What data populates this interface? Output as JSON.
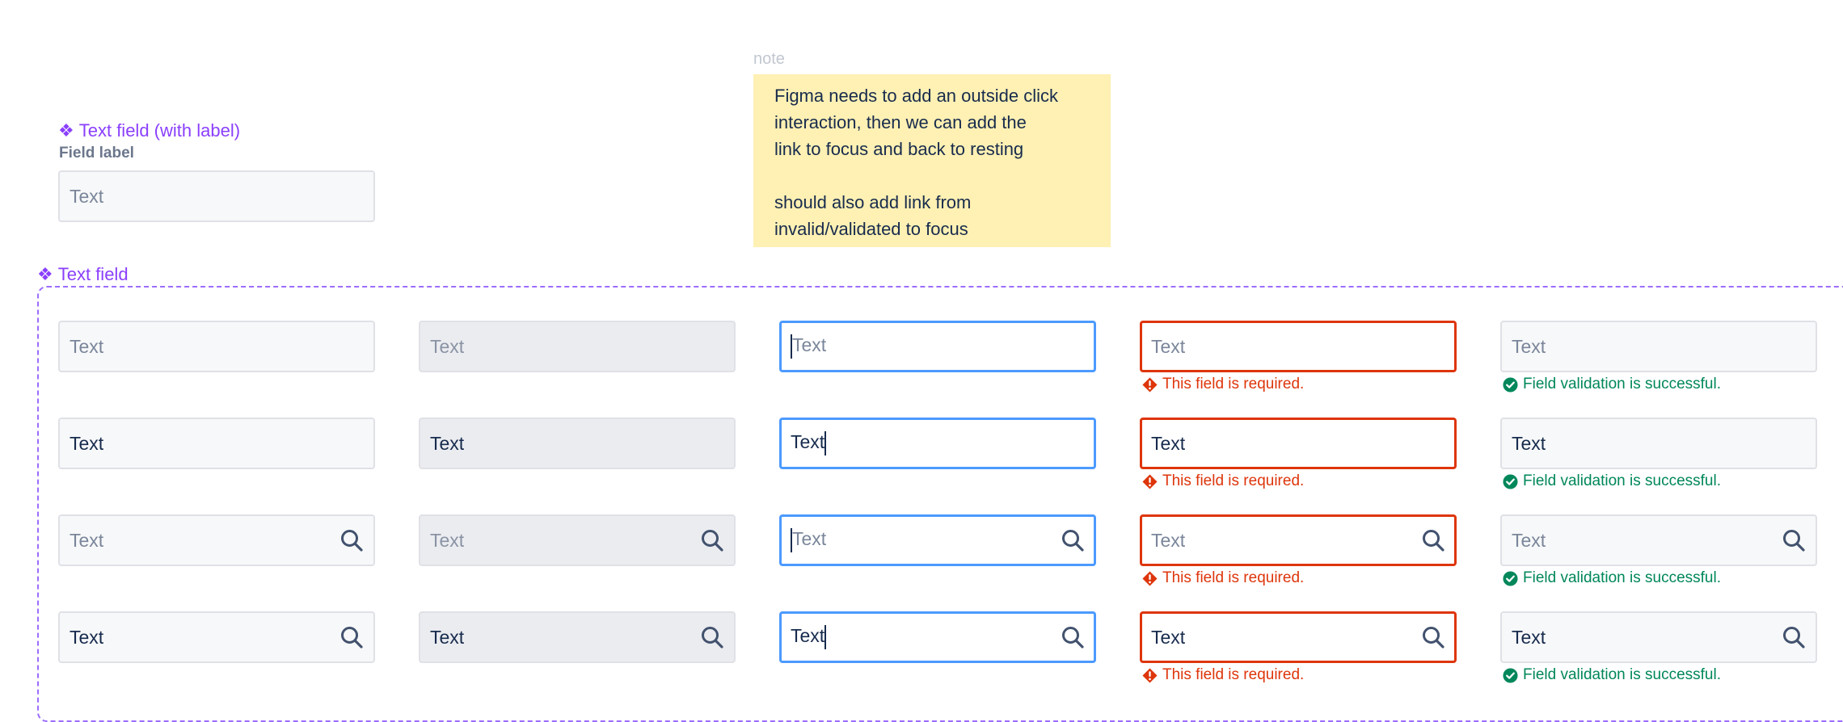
{
  "labeled_component": {
    "title": "Text field (with label)",
    "field_label": "Field label",
    "input_placeholder": "Text"
  },
  "note": {
    "tag": "note",
    "lines": [
      "Figma needs to add an outside click",
      "interaction, then we can add the",
      "link to focus and back to resting",
      "",
      "should also add link from",
      "invalid/validated to focus"
    ]
  },
  "component": {
    "title": "Text field",
    "glyph": "❖",
    "placeholder": "Text",
    "value": "Text",
    "columns": [
      "default",
      "disabled",
      "focus",
      "invalid",
      "valid"
    ],
    "error_message": "This field is required.",
    "success_message": "Field validation is successful."
  },
  "colors": {
    "component_purple": "#8a3ffc",
    "focus_blue": "#4c9aff",
    "error_red": "#de350b",
    "success_green": "#00875a",
    "note_yellow": "#fff0b3"
  }
}
